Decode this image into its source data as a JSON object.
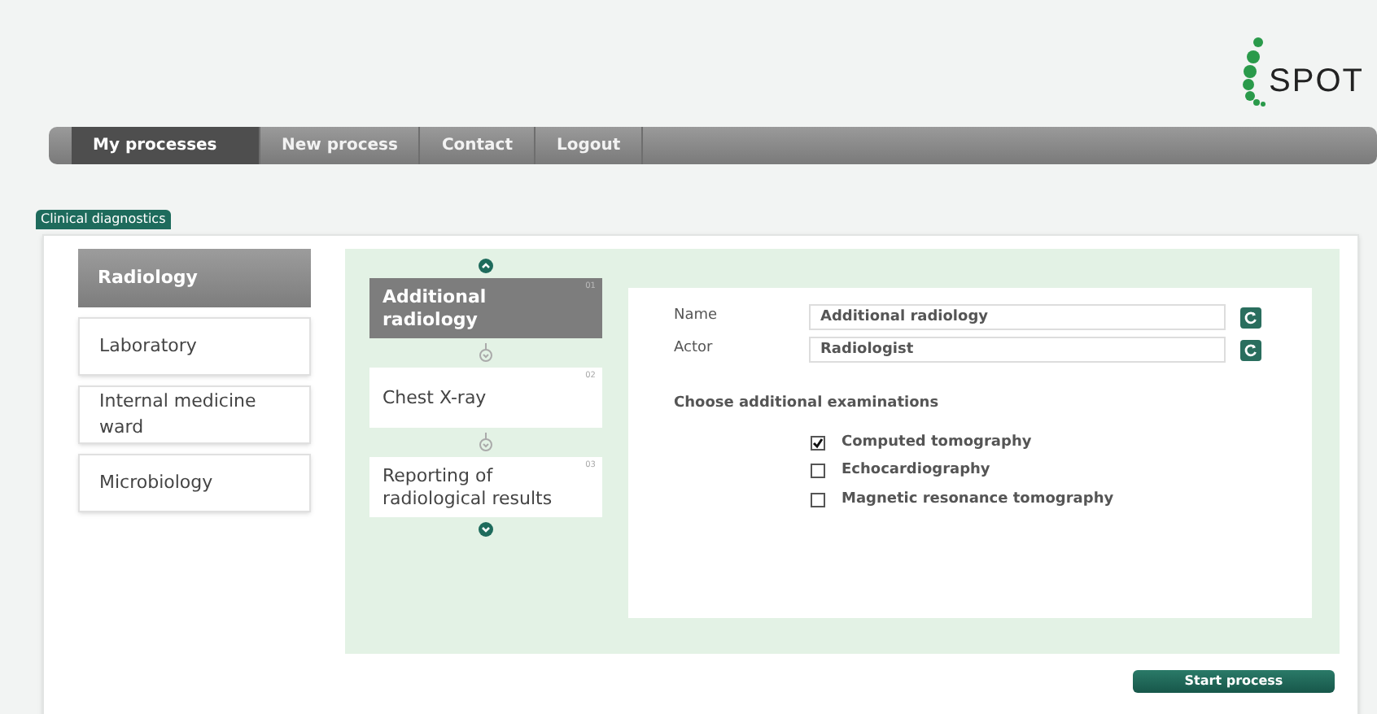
{
  "logo": {
    "text": "SPOT"
  },
  "nav": [
    {
      "label": "My processes",
      "selected": true
    },
    {
      "label": "New process",
      "selected": false
    },
    {
      "label": "Contact",
      "selected": false
    },
    {
      "label": "Logout",
      "selected": false
    }
  ],
  "section_tab": "Clinical diagnostics",
  "departments": [
    {
      "label": "Radiology",
      "selected": true
    },
    {
      "label": "Laboratory",
      "selected": false
    },
    {
      "label": "Internal medicine ward",
      "selected": false
    },
    {
      "label": "Microbiology",
      "selected": false
    }
  ],
  "steps": [
    {
      "label": "Additional radiology",
      "number": "01",
      "selected": true
    },
    {
      "label": "Chest X-ray",
      "number": "02",
      "selected": false
    },
    {
      "label": "Reporting of radiological results",
      "number": "03",
      "selected": false
    }
  ],
  "details": {
    "fields": [
      {
        "label": "Name",
        "value": "Additional radiology"
      },
      {
        "label": "Actor",
        "value": "Radiologist"
      }
    ],
    "examinations_heading": "Choose additional examinations",
    "examinations": [
      {
        "label": "Computed tomography",
        "checked": true
      },
      {
        "label": "Echocardiography",
        "checked": false
      },
      {
        "label": "Magnetic resonance tomography",
        "checked": false
      }
    ]
  },
  "start_button": "Start process"
}
